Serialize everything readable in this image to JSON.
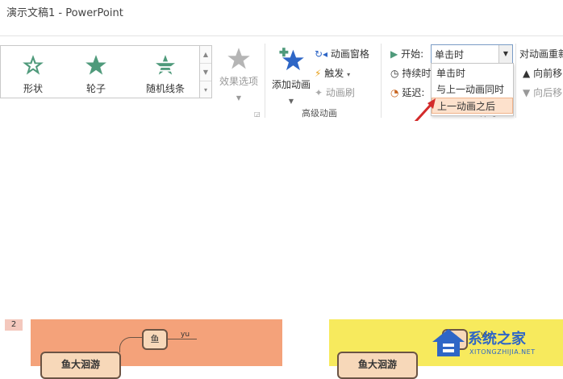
{
  "window": {
    "title": "演示文稿1 - PowerPoint"
  },
  "gallery": {
    "items": [
      {
        "label": "形状",
        "icon": "star-icon"
      },
      {
        "label": "轮子",
        "icon": "star-icon"
      },
      {
        "label": "随机线条",
        "icon": "random-bars-star-icon"
      }
    ]
  },
  "effect_options": {
    "label": "效果选项"
  },
  "advanced_animation": {
    "add_animation": "添加动画",
    "animation_pane": "动画窗格",
    "trigger": "触发",
    "animation_painter": "动画刷",
    "group_label": "高级动画"
  },
  "timing": {
    "start_label": "开始:",
    "start_value": "单击时",
    "duration_label": "持续时",
    "delay_label": "延迟:",
    "group_label": "计时",
    "dropdown_options": [
      "单击时",
      "与上一动画同时",
      "上一动画之后"
    ],
    "selected_index": 2
  },
  "reorder": {
    "title": "对动画重新",
    "move_earlier": "向前移",
    "move_later": "向后移"
  },
  "slides": {
    "badge": "2",
    "node_label": "鱼",
    "node_tag": "yu",
    "main_node": "鱼大洄游"
  },
  "watermark": {
    "brand": "系统之家",
    "url": "XITONGZHIJIA.NET"
  },
  "colors": {
    "star_green": "#4f9a7b",
    "arrow_red": "#d32b2b",
    "accent_blue": "#2e66c6"
  }
}
